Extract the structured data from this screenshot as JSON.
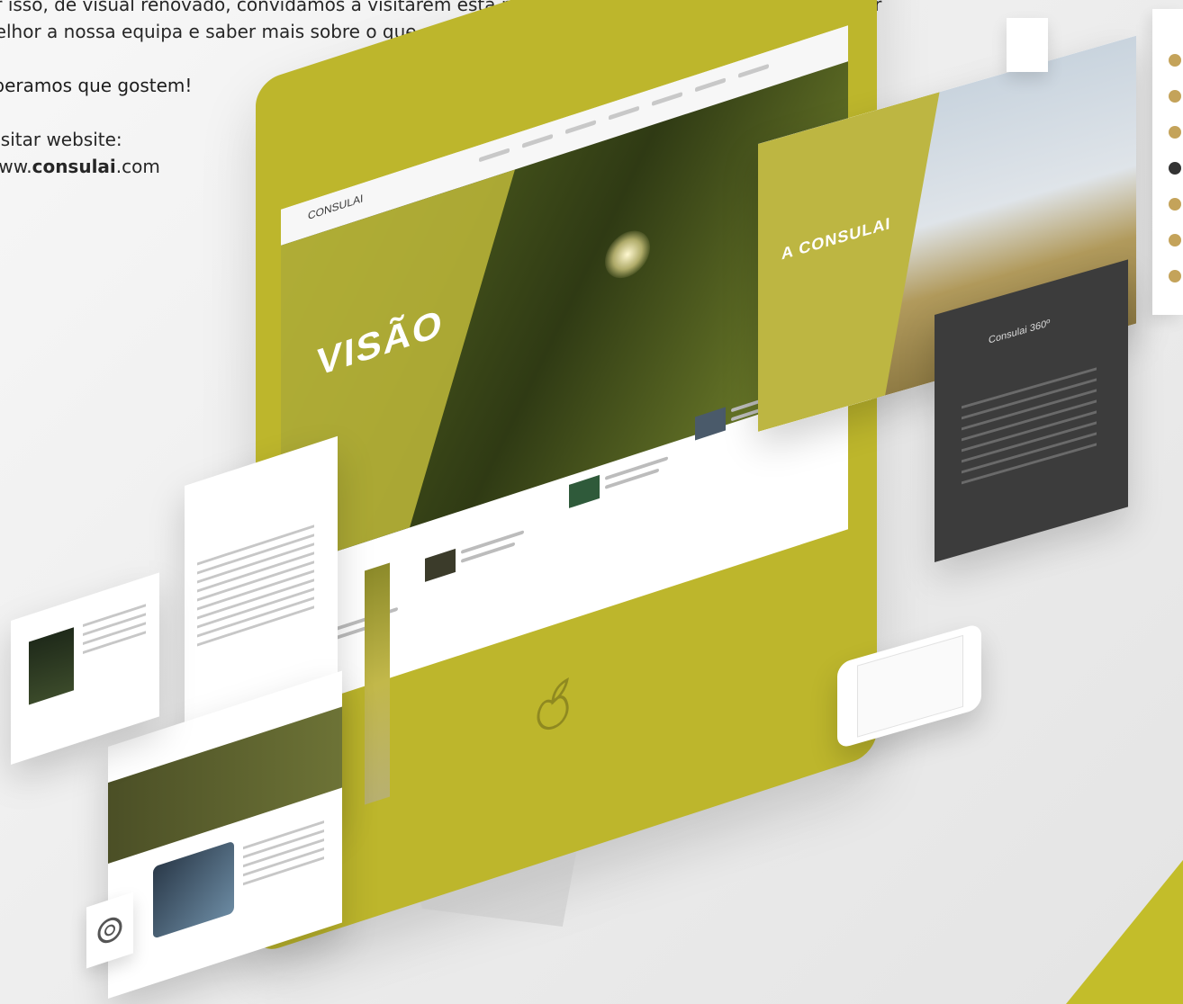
{
  "intro": {
    "line1": "or isso, de visual renovado, convidamos a visitarem esta nossa “nova casa”, onde podem conhecer",
    "line2": "nelhor a nossa equipa e saber mais sobre o que andamos a fazer.",
    "greeting": "speramos que gostem!",
    "visit_label": "Visitar website:",
    "url_prefix": "www.",
    "url_bold": "consulai",
    "url_suffix": ".com"
  },
  "mockup": {
    "monitor_logo_text": "CONSULAI",
    "monitor_hero_title": "VISÃO",
    "right_panel_title": "A CONSULAI",
    "dark_panel_title": "Consulai 360º"
  },
  "colors": {
    "brand_olive": "#bdb62c",
    "accent_corner": "#c3bd2a"
  },
  "icons": {
    "monitor_logo": "leaf-logo-icon",
    "gear": "gear-icon"
  }
}
